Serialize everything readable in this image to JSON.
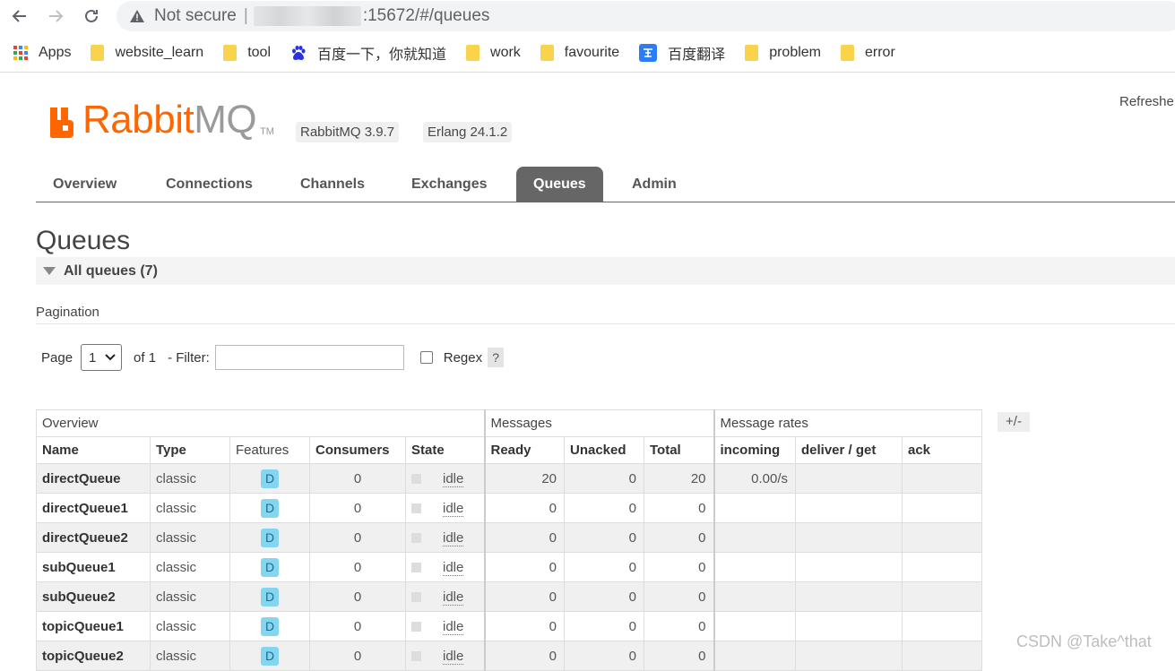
{
  "browser": {
    "security": "Not secure",
    "separator": "|",
    "url": ":15672/#/queues",
    "bookmarks": [
      {
        "label": "Apps",
        "icon": "apps-grid-icon"
      },
      {
        "label": "website_learn",
        "icon": "folder-icon"
      },
      {
        "label": "tool",
        "icon": "folder-icon"
      },
      {
        "label": "百度一下，你就知道",
        "icon": "baidu-paw-icon"
      },
      {
        "label": "work",
        "icon": "folder-icon"
      },
      {
        "label": "favourite",
        "icon": "folder-icon"
      },
      {
        "label": "百度翻译",
        "icon": "baidu-translate-icon"
      },
      {
        "label": "problem",
        "icon": "folder-icon"
      },
      {
        "label": "error",
        "icon": "folder-icon"
      }
    ]
  },
  "header": {
    "logo_part1": "Rabbit",
    "logo_part2": "MQ",
    "logo_tm": "TM",
    "version": "RabbitMQ 3.9.7",
    "erlang": "Erlang 24.1.2",
    "refresh": "Refreshe",
    "brand_color": "#ff6600"
  },
  "tabs": [
    "Overview",
    "Connections",
    "Channels",
    "Exchanges",
    "Queues",
    "Admin"
  ],
  "active_tab": "Queues",
  "page": {
    "title": "Queues",
    "section": "All queues (7)"
  },
  "pagination": {
    "title": "Pagination",
    "page_label": "Page",
    "page_value": "1",
    "of_label": "of 1",
    "filter_label": "- Filter:",
    "regex_label": "Regex",
    "help": "?"
  },
  "table": {
    "groups": [
      "Overview",
      "Messages",
      "Message rates"
    ],
    "columns": [
      "Name",
      "Type",
      "Features",
      "Consumers",
      "State",
      "Ready",
      "Unacked",
      "Total",
      "incoming",
      "deliver / get",
      "ack"
    ],
    "plus_minus": "+/-",
    "rows": [
      {
        "name": "directQueue",
        "type": "classic",
        "feature": "D",
        "consumers": "0",
        "state": "idle",
        "ready": "20",
        "unacked": "0",
        "total": "20",
        "incoming": "0.00/s",
        "deliver": "",
        "ack": ""
      },
      {
        "name": "directQueue1",
        "type": "classic",
        "feature": "D",
        "consumers": "0",
        "state": "idle",
        "ready": "0",
        "unacked": "0",
        "total": "0",
        "incoming": "",
        "deliver": "",
        "ack": ""
      },
      {
        "name": "directQueue2",
        "type": "classic",
        "feature": "D",
        "consumers": "0",
        "state": "idle",
        "ready": "0",
        "unacked": "0",
        "total": "0",
        "incoming": "",
        "deliver": "",
        "ack": ""
      },
      {
        "name": "subQueue1",
        "type": "classic",
        "feature": "D",
        "consumers": "0",
        "state": "idle",
        "ready": "0",
        "unacked": "0",
        "total": "0",
        "incoming": "",
        "deliver": "",
        "ack": ""
      },
      {
        "name": "subQueue2",
        "type": "classic",
        "feature": "D",
        "consumers": "0",
        "state": "idle",
        "ready": "0",
        "unacked": "0",
        "total": "0",
        "incoming": "",
        "deliver": "",
        "ack": ""
      },
      {
        "name": "topicQueue1",
        "type": "classic",
        "feature": "D",
        "consumers": "0",
        "state": "idle",
        "ready": "0",
        "unacked": "0",
        "total": "0",
        "incoming": "",
        "deliver": "",
        "ack": ""
      },
      {
        "name": "topicQueue2",
        "type": "classic",
        "feature": "D",
        "consumers": "0",
        "state": "idle",
        "ready": "0",
        "unacked": "0",
        "total": "0",
        "incoming": "",
        "deliver": "",
        "ack": ""
      }
    ]
  },
  "watermark": "CSDN @Take^that"
}
